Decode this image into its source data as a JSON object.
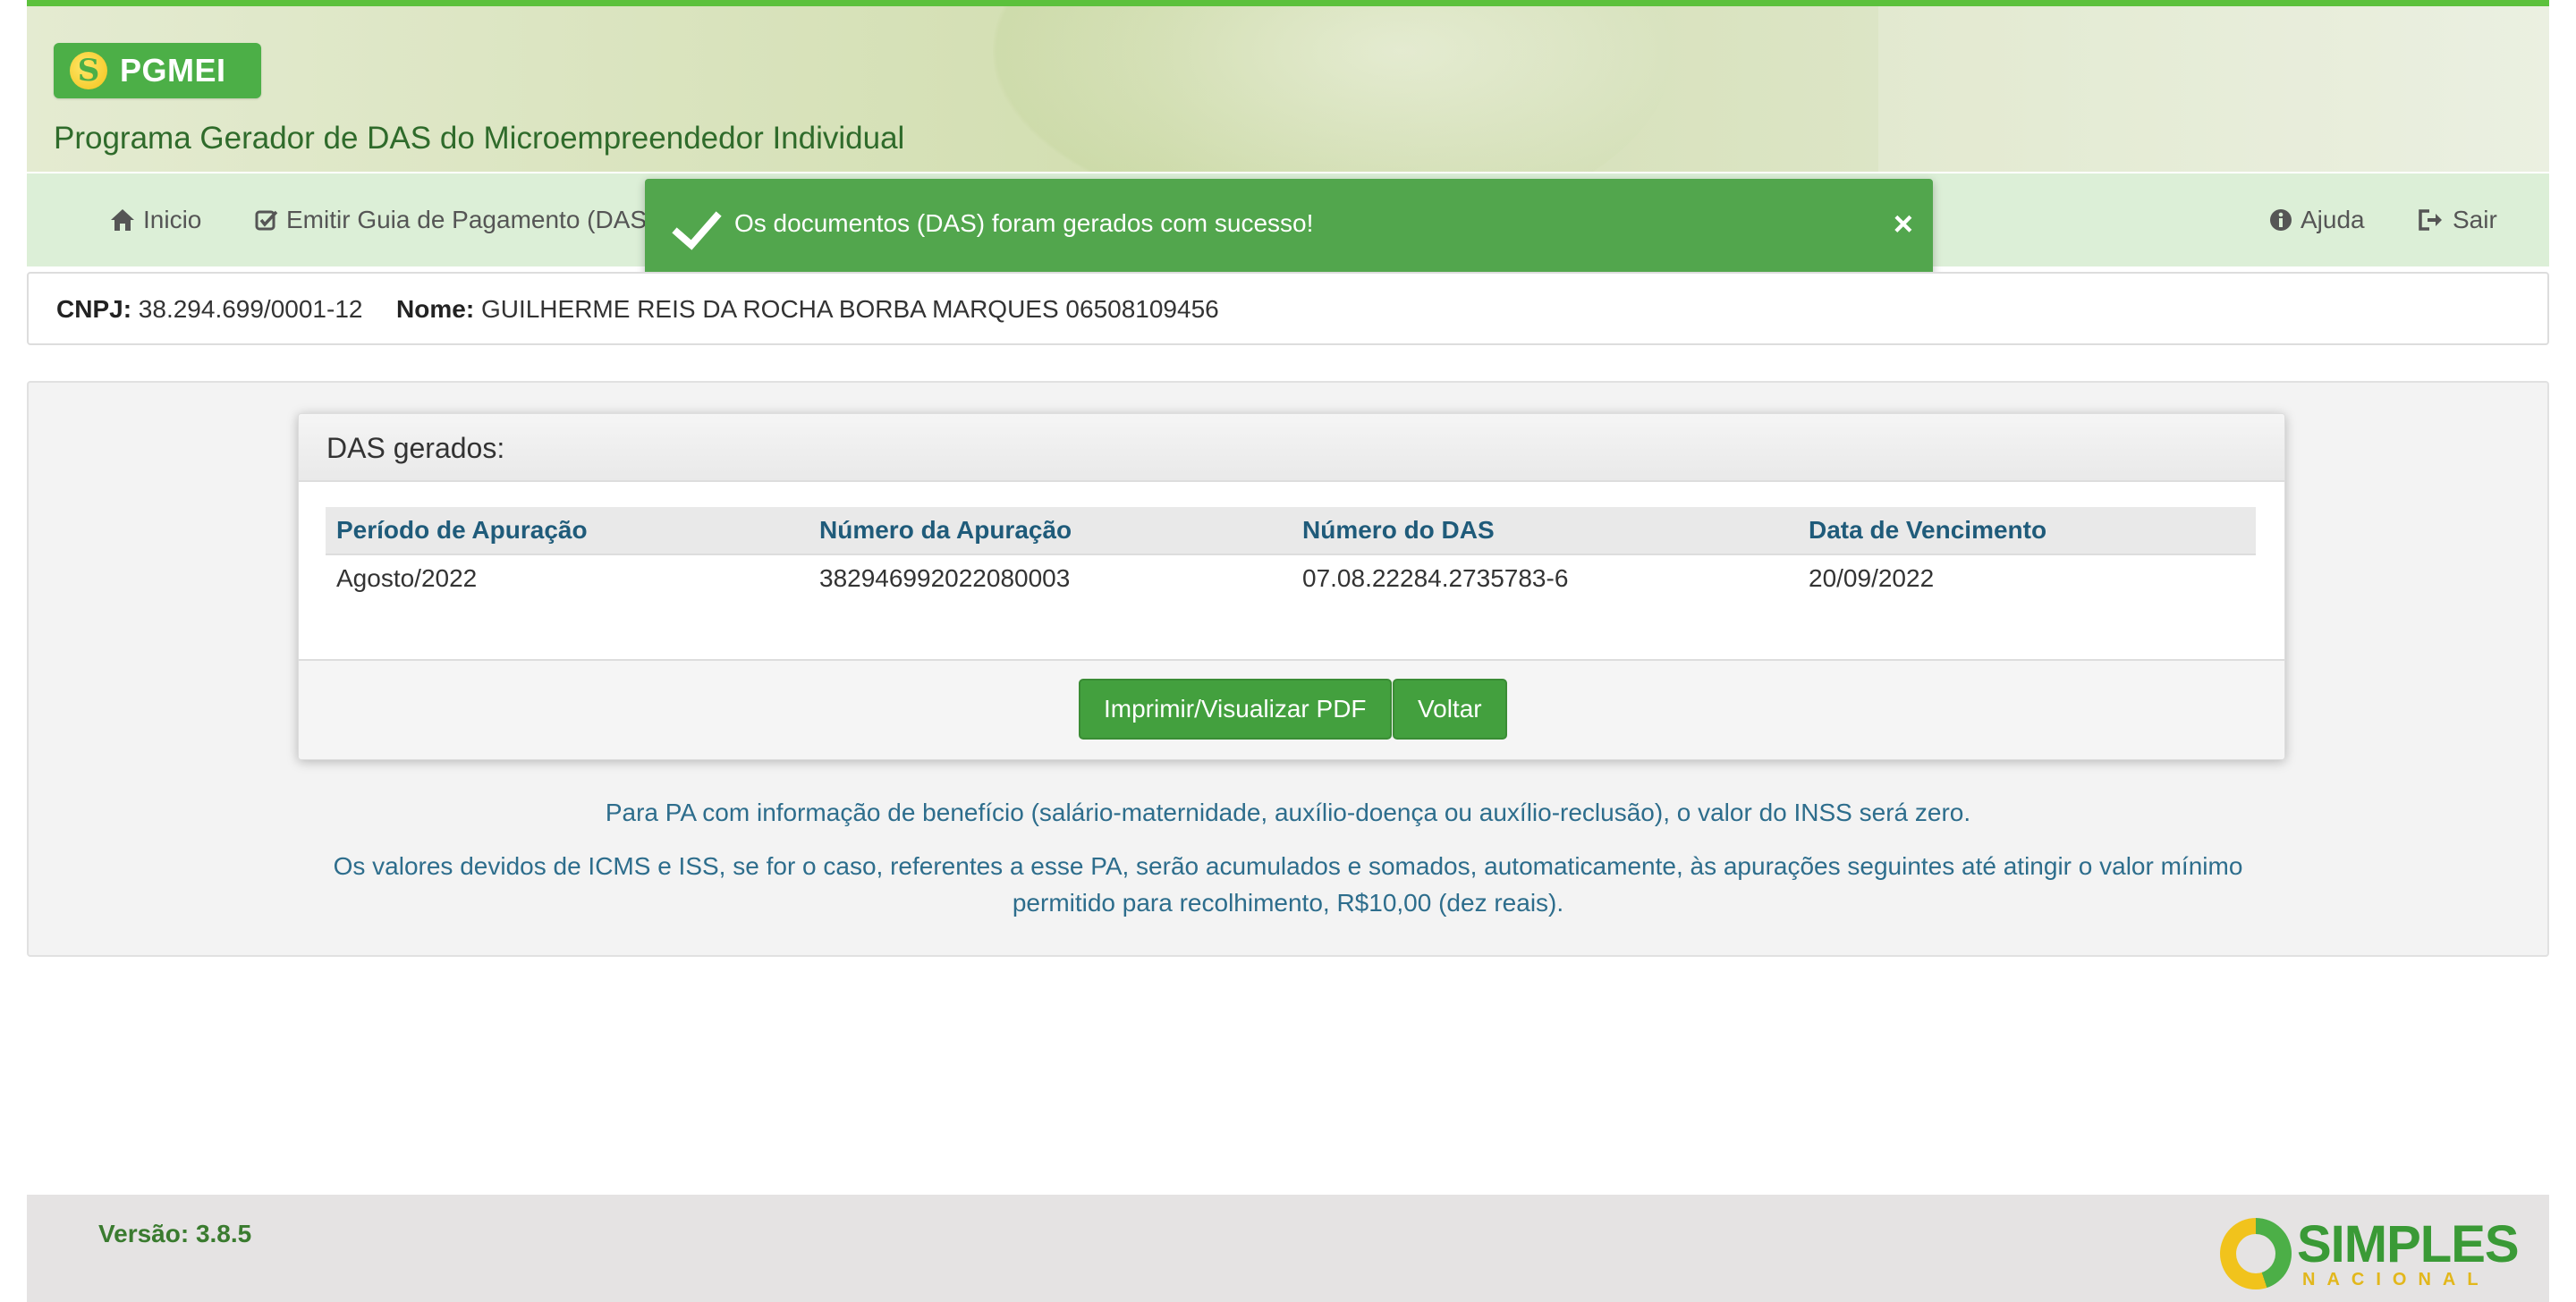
{
  "header": {
    "logo_text": "PGMEI",
    "app_title": "Programa Gerador de DAS do Microempreendedor Individual"
  },
  "nav": {
    "inicio": "Inicio",
    "emitir": "Emitir Guia de Pagamento (DAS",
    "ajuda": "Ajuda",
    "sair": "Sair"
  },
  "toast": {
    "message": "Os documentos (DAS) foram gerados com sucesso!",
    "close": "×"
  },
  "identity": {
    "cnpj_label": "CNPJ:",
    "cnpj": "38.294.699/0001-12",
    "nome_label": "Nome:",
    "nome": "GUILHERME REIS DA ROCHA BORBA MARQUES 06508109456"
  },
  "panel": {
    "title": "DAS gerados:",
    "columns": [
      "Período de Apuração",
      "Número da Apuração",
      "Número do DAS",
      "Data de Vencimento"
    ],
    "rows": [
      [
        "Agosto/2022",
        "382946992022080003",
        "07.08.22284.2735783-6",
        "20/09/2022"
      ]
    ],
    "print_button": "Imprimir/Visualizar PDF",
    "back_button": "Voltar"
  },
  "notes": {
    "note1": "Para PA com informação de benefício (salário-maternidade, auxílio-doença ou auxílio-reclusão), o valor do INSS será zero.",
    "note2_line1": "Os valores devidos de ICMS e ISS, se for o caso, referentes a esse PA, serão acumulados e somados, automaticamente, às apurações seguintes até atingir o valor mínimo",
    "note2_line2": "permitido para recolhimento, R$10,00 (dez reais)."
  },
  "footer": {
    "version": "Versão: 3.8.5",
    "brand_word1": "SIMPLES",
    "brand_word2": "NACIONAL"
  },
  "colors": {
    "brand_green": "#4caf47",
    "toast_green": "#52a64d",
    "table_header_text": "#1f5b7a",
    "note_text": "#2d6d8c"
  }
}
